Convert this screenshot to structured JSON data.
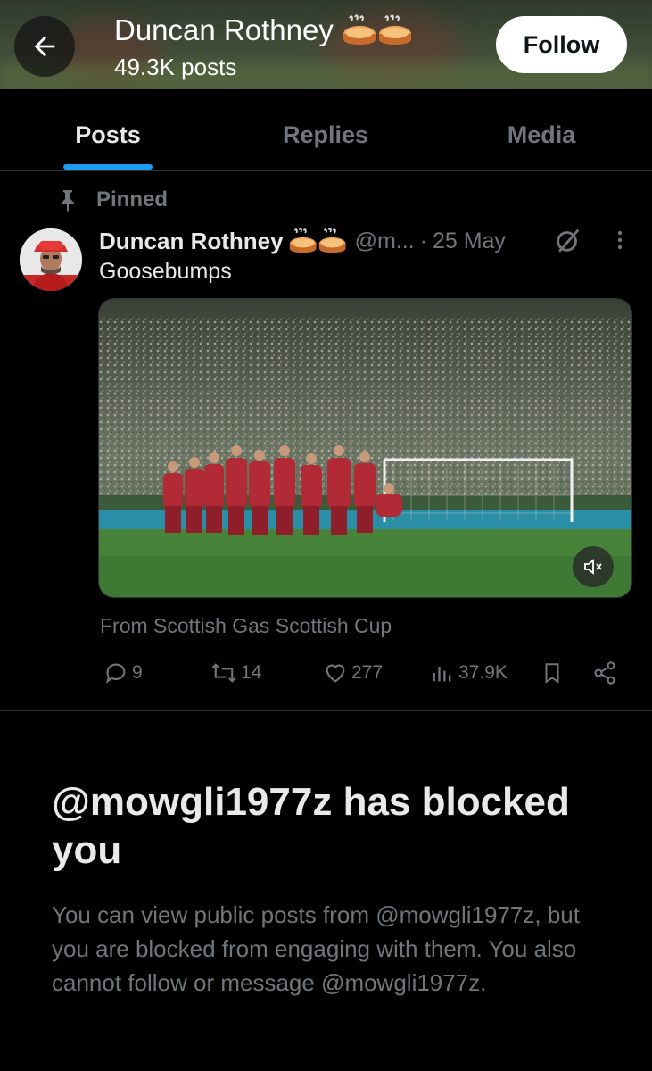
{
  "header": {
    "name": "Duncan Rothney",
    "posts_count": "49.3K posts",
    "follow_label": "Follow"
  },
  "tabs": [
    {
      "label": "Posts",
      "active": true
    },
    {
      "label": "Replies",
      "active": false
    },
    {
      "label": "Media",
      "active": false
    }
  ],
  "post": {
    "pinned_label": "Pinned",
    "author": "Duncan Rothney",
    "handle": "@m...",
    "dot": "·",
    "date": "25 May",
    "text": "Goosebumps",
    "source": "From Scottish Gas Scottish Cup",
    "stats": {
      "replies": "9",
      "reposts": "14",
      "likes": "277",
      "views": "37.9K"
    }
  },
  "blocked": {
    "title": "@mowgli1977z has blocked you",
    "body": "You can view public posts from @mowgli1977z, but you are blocked from engaging with them. You also cannot follow or message @mowgli1977z."
  },
  "colors": {
    "accent": "#1d9bf0",
    "muted": "#71767b",
    "text": "#e7e9ea",
    "background": "#000000"
  },
  "icons": [
    "back-arrow-icon",
    "pie-emoji-icon",
    "pin-icon",
    "grok-icon",
    "more-icon",
    "mute-icon",
    "reply-icon",
    "repost-icon",
    "like-icon",
    "views-icon",
    "bookmark-icon",
    "share-icon"
  ]
}
